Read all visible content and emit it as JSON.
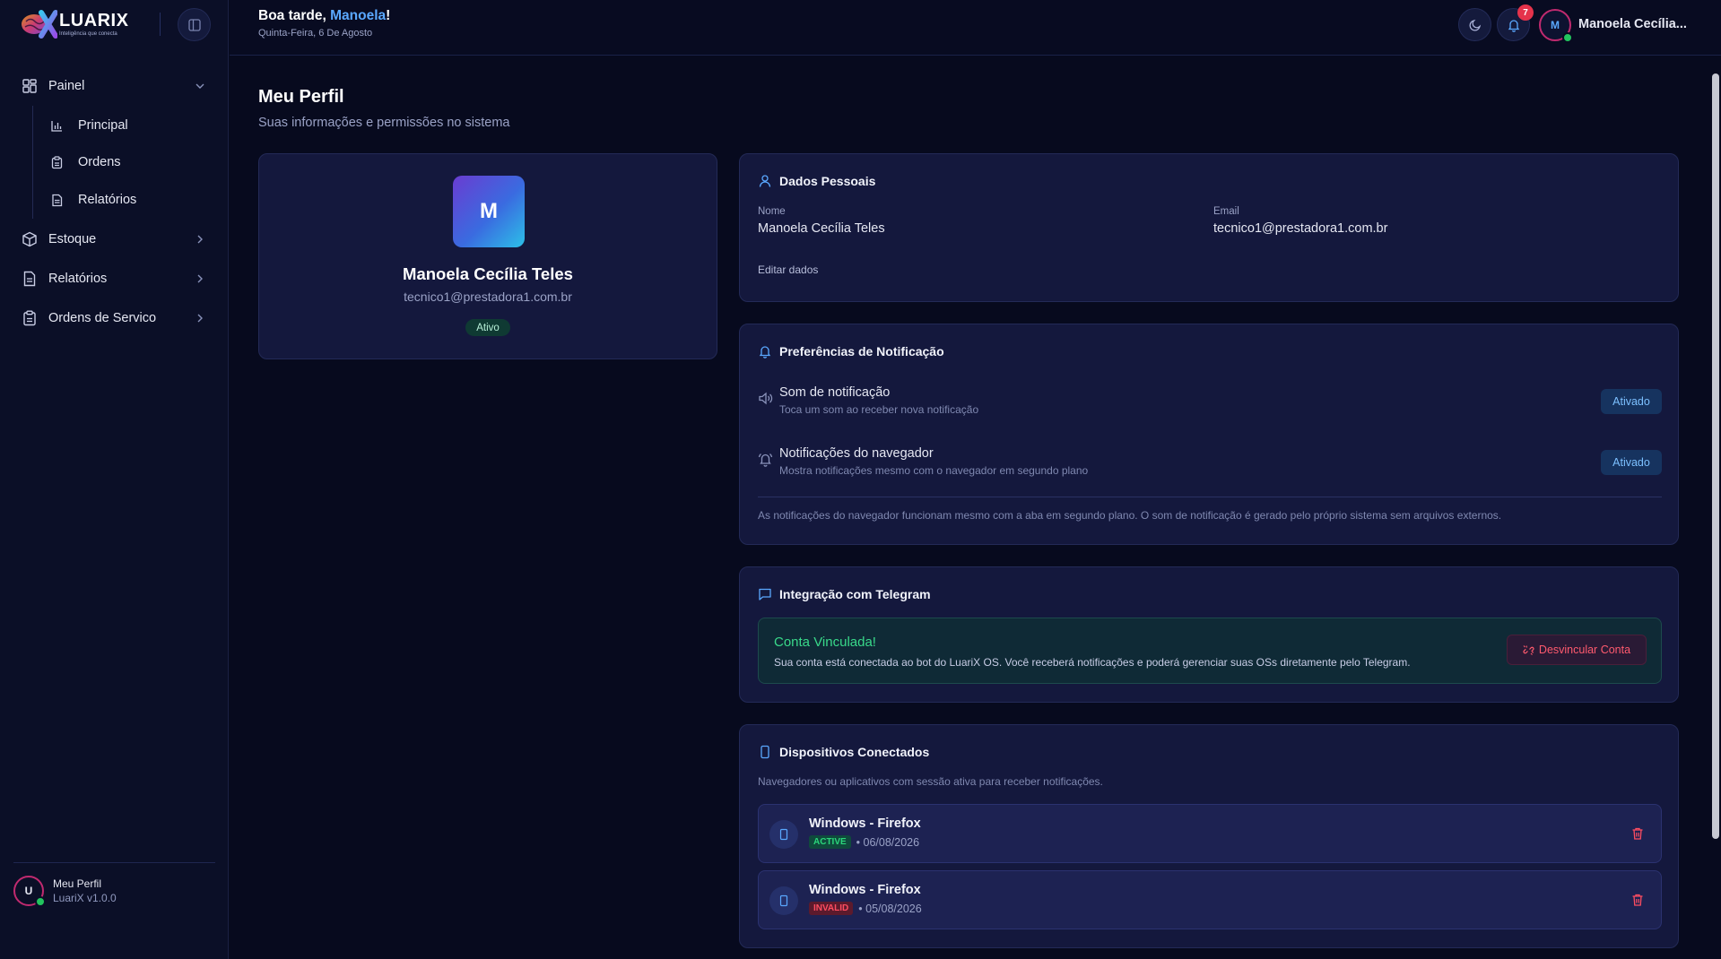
{
  "brand": {
    "name": "LUARIX",
    "tagline": "Inteligência que conecta"
  },
  "sidebar": {
    "items": [
      {
        "label": "Painel",
        "icon": "dashboard-icon",
        "expanded": true
      },
      {
        "label": "Estoque",
        "icon": "package-icon"
      },
      {
        "label": "Relatórios",
        "icon": "report-icon"
      },
      {
        "label": "Ordens de Servico",
        "icon": "clipboard-icon"
      }
    ],
    "sub_items": [
      {
        "label": "Principal",
        "icon": "bar-chart-icon"
      },
      {
        "label": "Ordens",
        "icon": "clipboard-icon"
      },
      {
        "label": "Relatórios",
        "icon": "document-icon"
      }
    ],
    "footer": {
      "avatar_initial": "U",
      "name": "Meu Perfil",
      "version": "LuariX v1.0.0"
    }
  },
  "header": {
    "greeting_prefix": "Boa tarde, ",
    "greeting_name": "Manoela",
    "greeting_suffix": "!",
    "date": "Quinta-Feira, 6 De Agosto",
    "notification_count": "7",
    "avatar_initial": "M",
    "user_name": "Manoela Cecília..."
  },
  "page": {
    "title": "Meu Perfil",
    "subtitle": "Suas informações e permissões no sistema"
  },
  "profile": {
    "avatar_initial": "M",
    "name": "Manoela Cecília Teles",
    "email": "tecnico1@prestadora1.com.br",
    "status": "Ativo"
  },
  "personal": {
    "title": "Dados Pessoais",
    "name_label": "Nome",
    "name_value": "Manoela Cecília Teles",
    "email_label": "Email",
    "email_value": "tecnico1@prestadora1.com.br",
    "edit_label": "Editar dados"
  },
  "notifications": {
    "title": "Preferências de Notificação",
    "prefs": [
      {
        "title": "Som de notificação",
        "desc": "Toca um som ao receber nova notificação",
        "state": "Ativado"
      },
      {
        "title": "Notificações do navegador",
        "desc": "Mostra notificações mesmo com o navegador em segundo plano",
        "state": "Ativado"
      }
    ],
    "note": "As notificações do navegador funcionam mesmo com a aba em segundo plano. O som de notificação é gerado pelo próprio sistema sem arquivos externos."
  },
  "telegram": {
    "title": "Integração com Telegram",
    "linked_title": "Conta Vinculada!",
    "linked_desc": "Sua conta está conectada ao bot do LuariX OS. Você receberá notificações e poderá gerenciar suas OSs diretamente pelo Telegram.",
    "unlink_label": "Desvincular Conta"
  },
  "devices": {
    "title": "Dispositivos Conectados",
    "desc": "Navegadores ou aplicativos com sessão ativa para receber notificações.",
    "list": [
      {
        "name": "Windows - Firefox",
        "status": "ACTIVE",
        "date": "• 06/08/2026"
      },
      {
        "name": "Windows - Firefox",
        "status": "INVALID",
        "date": "• 05/08/2026"
      }
    ]
  },
  "colors": {
    "background": "#070a1e",
    "card": "#14183d",
    "accent": "#5aa8ff",
    "success": "#22c55e",
    "danger": "#ff4d61"
  }
}
